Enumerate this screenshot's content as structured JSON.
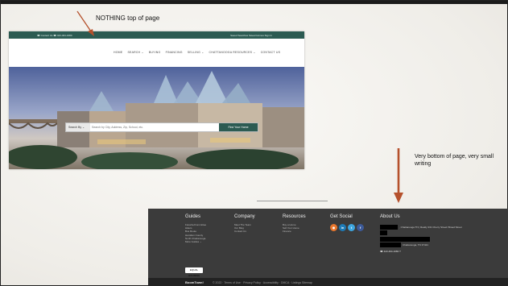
{
  "annotations": {
    "top_note": "NOTHING top of page",
    "bottom_note": "Very bottom of page, very small writing"
  },
  "colors": {
    "arrow": "#b5512c",
    "brand": "#2c5b52",
    "footer_bg": "#3b3b3b"
  },
  "header": {
    "topbar_left": "☎ Contact Us  ☎ 423-464-1680",
    "topbar_right": "Saved Searches  Saved Homes  Sign In",
    "nav_items": [
      "HOME",
      "SEARCH ⌄",
      "BUYING",
      "FINANCING",
      "SELLING ⌄",
      "CHATTANOOGA RESOURCES ⌄",
      "CONTACT US"
    ]
  },
  "search": {
    "type_label": "Search By ⌄",
    "placeholder": "Search by City, Address, Zip, School, etc.",
    "button": "Find Your Home"
  },
  "footer": {
    "guides": {
      "heading": "Guides",
      "items": [
        "Favorite/Committee",
        "Hikers",
        "Bus Route",
        "Hamilton County",
        "North Chattanooga",
        "More Guides ⌄"
      ]
    },
    "company": {
      "heading": "Company",
      "items": [
        "Meet The Team",
        "Our Blog",
        "Contact Us"
      ]
    },
    "resources": {
      "heading": "Resources",
      "items": [
        "Buy a Home",
        "Sell Your Home",
        "Finance"
      ]
    },
    "social": {
      "heading": "Get Social",
      "icons": [
        "rss-icon",
        "linkedin-icon",
        "twitter-icon",
        "facebook-icon"
      ]
    },
    "about": {
      "heading": "About Us",
      "line1": ", Chattanooga TN | Realty 331 Cherry Street/ Broad Street",
      "line2": "Chattanooga, TN 37421",
      "phone": "☎ 423-464-1680 ?"
    },
    "eho_label": "EQUAL HOUSING",
    "bottom_logo": "BoomTown!",
    "bottom_links": "© 2022 · Terms of Use · Privacy Policy · Accessibility · DMCA · Listings Sitemap"
  }
}
